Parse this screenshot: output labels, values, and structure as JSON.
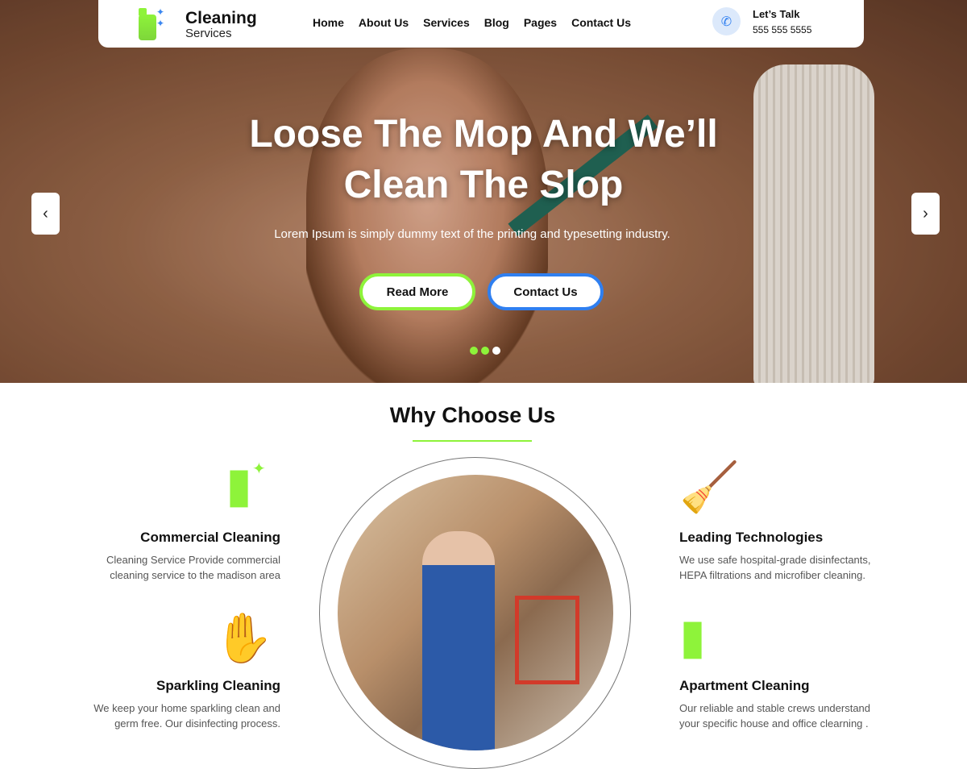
{
  "brand": {
    "name": "Cleaning",
    "sub": "Services"
  },
  "nav": [
    "Home",
    "About Us",
    "Services",
    "Blog",
    "Pages",
    "Contact Us"
  ],
  "contact": {
    "label": "Let’s Talk",
    "phone": "555 555 5555"
  },
  "hero": {
    "title_line1": "Loose  The  Mop And We’ll",
    "title_line2": "Clean The Slop",
    "subtitle": "Lorem Ipsum is simply dummy text of the printing and typesetting industry.",
    "read_more": "Read More",
    "contact_us": "Contact Us",
    "slide_active": 2,
    "slide_count": 3
  },
  "section": {
    "title": "Why Choose Us"
  },
  "features": [
    {
      "title": "Commercial Cleaning",
      "text": "Cleaning Service Provide commercial cleaning service to the madison area"
    },
    {
      "title": "Sparkling Cleaning",
      "text": "We keep your home sparkling clean and germ free. Our disinfecting process."
    },
    {
      "title": "Leading Technologies",
      "text": "We use safe hospital-grade disinfectants, HEPA filtrations and microfiber cleaning."
    },
    {
      "title": "Apartment Cleaning",
      "text": "Our reliable and stable crews understand your specific house and office clearning ."
    }
  ],
  "colors": {
    "accent": "#8ef33a",
    "blue": "#2f7ff0"
  }
}
